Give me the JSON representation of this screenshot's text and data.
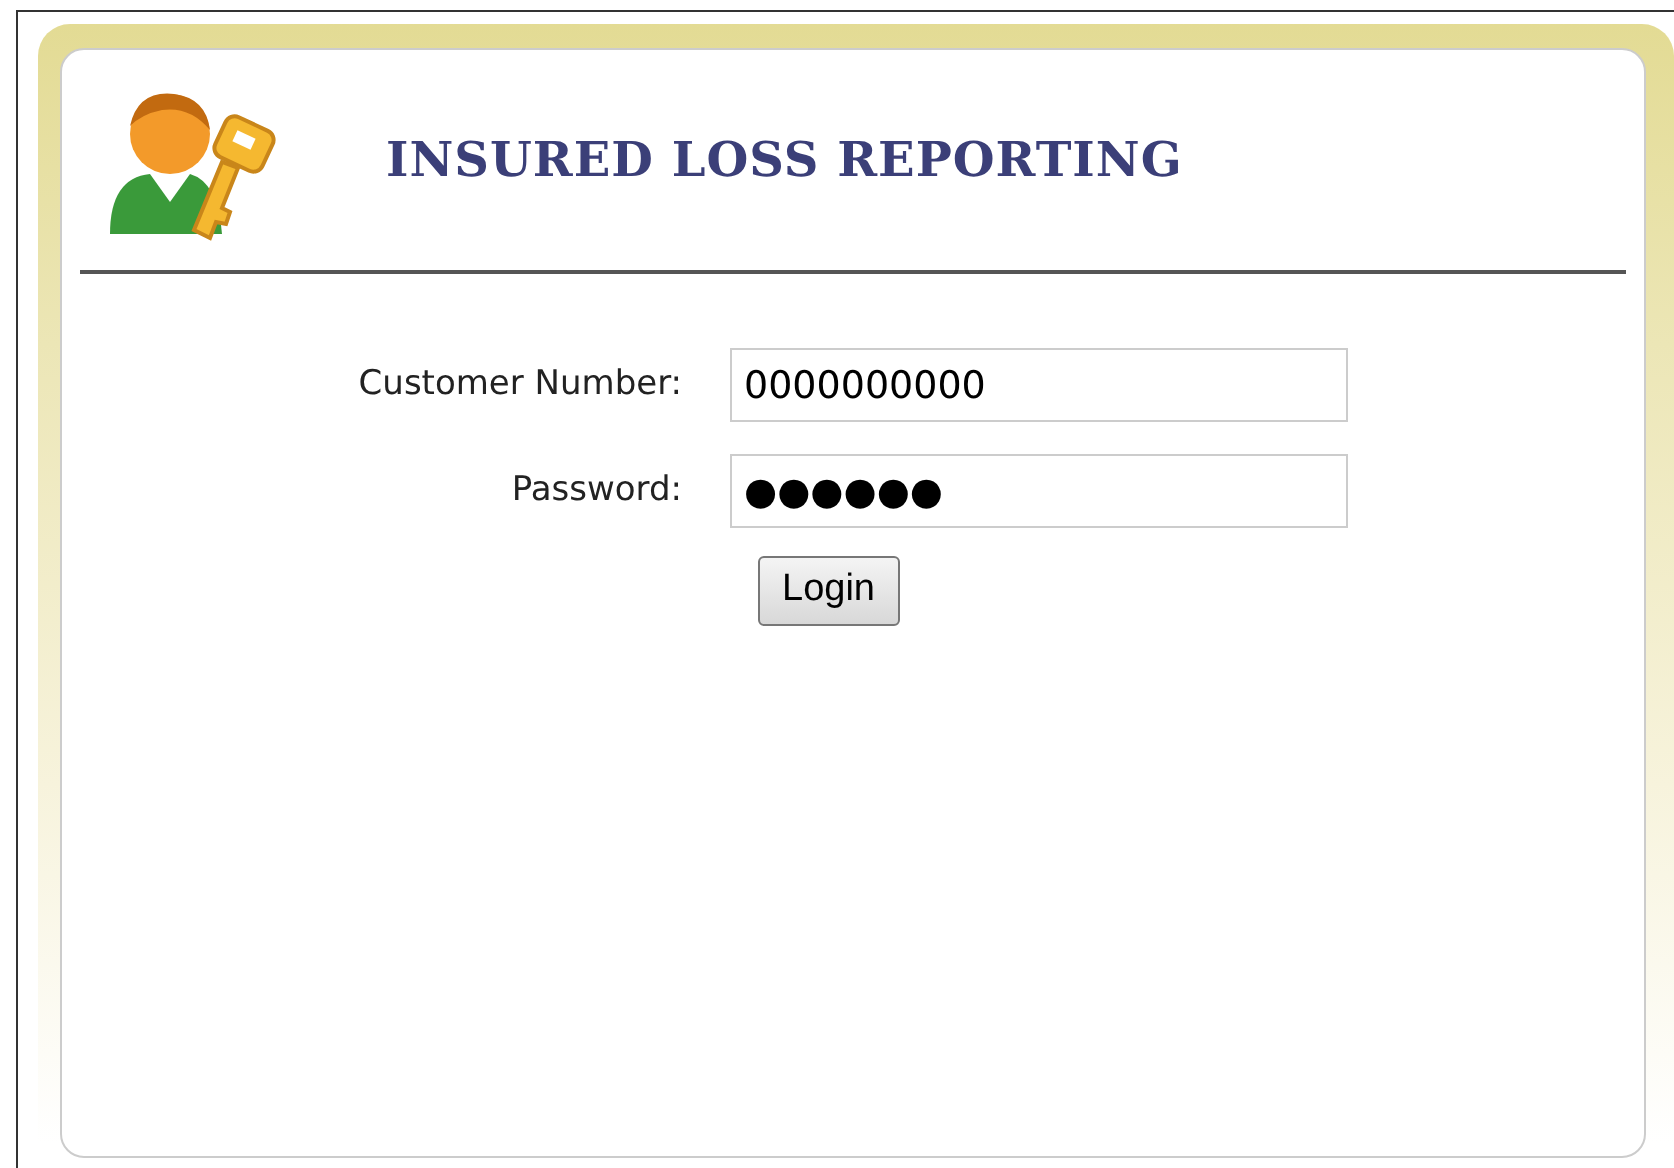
{
  "header": {
    "title": "INSURED LOSS REPORTING"
  },
  "form": {
    "fields": [
      {
        "label": "Customer Number:",
        "value": "0000000000"
      },
      {
        "label": "Password:",
        "value": "●●●●●●"
      }
    ],
    "submit": "Login"
  }
}
